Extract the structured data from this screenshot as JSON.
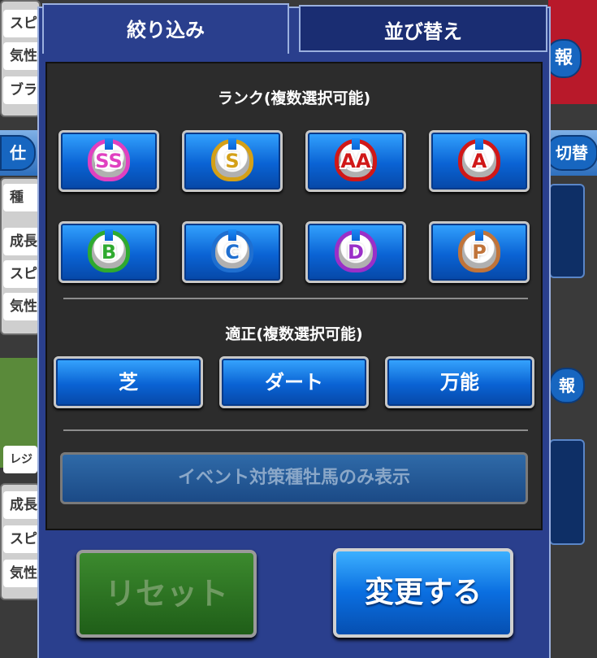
{
  "background": {
    "left_rows": [
      "スピ",
      "気性",
      "ブラ",
      "種",
      "成長",
      "スピ",
      "気性",
      "レジ",
      "成長",
      "スピ",
      "気性"
    ],
    "right_labels": [
      "報",
      "切替",
      "報"
    ],
    "left_pill": "仕"
  },
  "tabs": {
    "filter": "絞り込み",
    "sort": "並び替え"
  },
  "rank": {
    "title": "ランク(複数選択可能)",
    "options": [
      {
        "letter": "SS",
        "color": "#e040c0"
      },
      {
        "letter": "S",
        "color": "#d4a017"
      },
      {
        "letter": "AA",
        "color": "#d01818"
      },
      {
        "letter": "A",
        "color": "#d01818"
      },
      {
        "letter": "B",
        "color": "#2faa2f"
      },
      {
        "letter": "C",
        "color": "#1f6fd0"
      },
      {
        "letter": "D",
        "color": "#9a2fc8"
      },
      {
        "letter": "P",
        "color": "#c0743a"
      }
    ]
  },
  "aptitude": {
    "title": "適正(複数選択可能)",
    "options": [
      "芝",
      "ダート",
      "万能"
    ]
  },
  "event_filter_label": "イベント対策種牡馬のみ表示",
  "reset_label": "リセット",
  "apply_label": "変更する"
}
